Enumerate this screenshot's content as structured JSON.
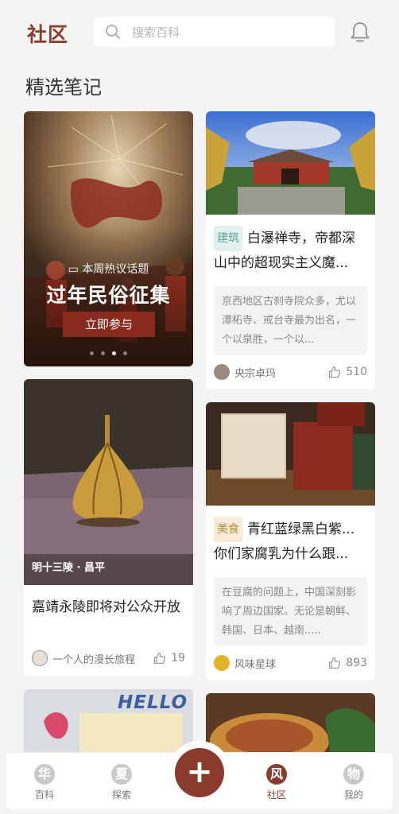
{
  "header": {
    "logo": "社区",
    "search_placeholder": "搜索百科"
  },
  "section_title": "精选笔记",
  "banner": {
    "subtitle": "本周热议话题",
    "title": "过年民俗征集",
    "button": "立即参与",
    "dots": 4,
    "active_dot": 3
  },
  "cards": [
    {
      "tag": "建筑",
      "title_line1": "白瀑禅寺，帝都深",
      "title_line2": "山中的超现实主义魔...",
      "excerpt": "京西地区古刹寺院众多，尤以潭柘寺、戒台寺最为出名，一个以泉胜，一个以...",
      "author": "央宗卓玛",
      "likes": "510"
    },
    {
      "image_caption": "明十三陵 · 昌平",
      "title": "嘉靖永陵即将对公众开放",
      "author": "一个人的漫长旅程",
      "likes": "19"
    },
    {
      "tag": "美食",
      "title_line1": "青红蓝绿黑白紫...",
      "title_line2": "你们家腐乳为什么跟...",
      "excerpt": "在豆腐的问题上，中国深刻影响了周边国家。无论是朝鲜、韩国、日本、越南.....",
      "author": "风味星球",
      "likes": "893"
    },
    {
      "image_caption": "HELLO"
    }
  ],
  "tabbar": {
    "items": [
      {
        "icon": "华",
        "label": "百科"
      },
      {
        "icon": "夏",
        "label": "探索"
      },
      {
        "icon": "风",
        "label": "社区"
      },
      {
        "icon": "物",
        "label": "我的"
      }
    ],
    "fab": "+"
  },
  "colors": {
    "accent": "#8a3b2b",
    "tag_green": "#5aa89a",
    "tag_beige": "#b58a3b"
  }
}
